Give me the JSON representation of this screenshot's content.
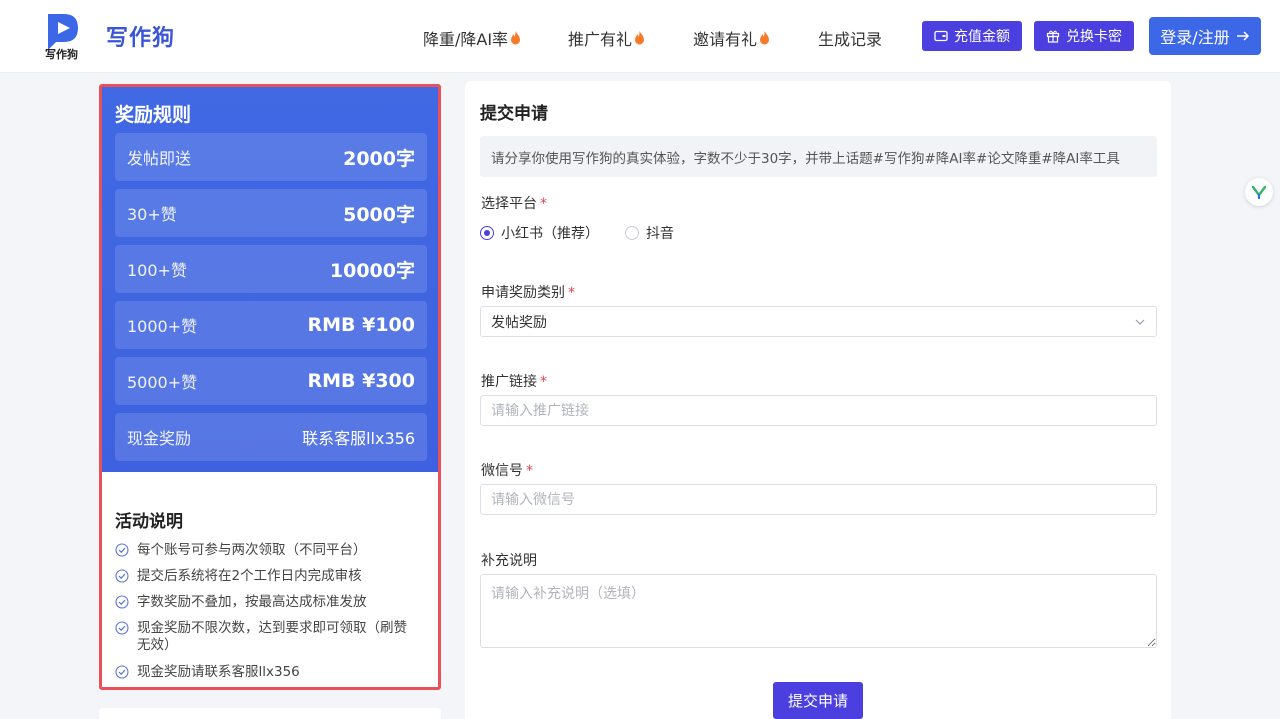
{
  "header": {
    "logo_text": "写作狗",
    "brand": "写作狗",
    "nav": [
      {
        "label": "降重/降AI率",
        "hot": true
      },
      {
        "label": "推广有礼",
        "hot": true
      },
      {
        "label": "邀请有礼",
        "hot": true
      },
      {
        "label": "生成记录",
        "hot": false
      }
    ],
    "recharge_label": "充值金额",
    "redeem_label": "兑换卡密",
    "login_label": "登录/注册"
  },
  "rules": {
    "title": "奖励规则",
    "items": [
      {
        "label": "发帖即送",
        "value": "2000字"
      },
      {
        "label": "30+赞",
        "value": "5000字"
      },
      {
        "label": "100+赞",
        "value": "10000字"
      },
      {
        "label": "1000+赞",
        "value": "RMB ¥100"
      },
      {
        "label": "5000+赞",
        "value": "RMB ¥300"
      },
      {
        "label": "现金奖励",
        "value": "联系客服llx356"
      }
    ]
  },
  "activity": {
    "title": "活动说明",
    "items": [
      "每个账号可参与两次领取（不同平台）",
      "提交后系统将在2个工作日内完成审核",
      "字数奖励不叠加，按最高达成标准发放",
      "现金奖励不限次数，达到要求即可领取（刷赞无效）",
      "现金奖励请联系客服llx356"
    ]
  },
  "form": {
    "title": "提交申请",
    "notice": "请分享你使用写作狗的真实体验，字数不少于30字，并带上话题#写作狗#降AI率#论文降重#降AI率工具",
    "platform_label": "选择平台",
    "platform_options": [
      "小红书（推荐）",
      "抖音"
    ],
    "platform_selected": "小红书（推荐）",
    "category_label": "申请奖励类别",
    "category_value": "发帖奖励",
    "link_label": "推广链接",
    "link_placeholder": "请输入推广链接",
    "wechat_label": "微信号",
    "wechat_placeholder": "请输入微信号",
    "note_label": "补充说明",
    "note_placeholder": "请输入补充说明（选填）",
    "submit_label": "提交申请",
    "required_mark": "*"
  },
  "colors": {
    "accent": "#4c3fe0",
    "primary_blue": "#3c68e8",
    "rules_bg": "#4169e4",
    "highlight_border": "#ea5058"
  }
}
